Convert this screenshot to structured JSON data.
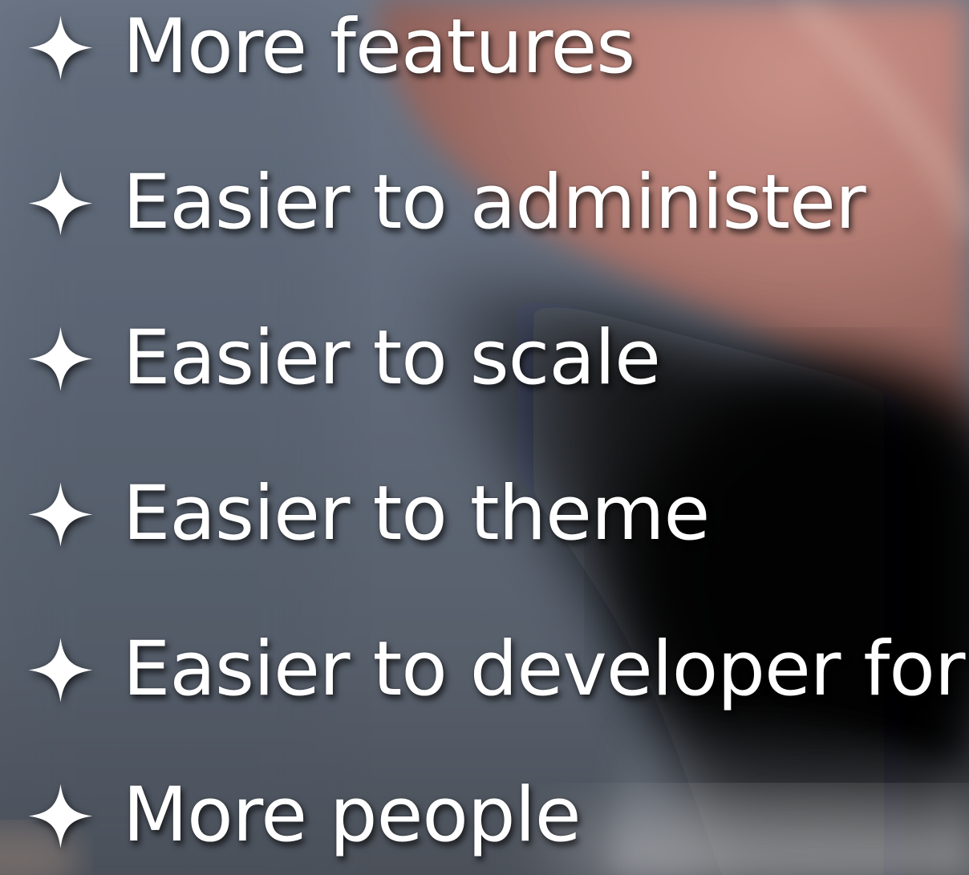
{
  "slide": {
    "bullet_icon": "four-point-star-icon",
    "text_color": "#ffffff",
    "items": [
      "More features",
      "Easier to administer",
      "Easier to scale",
      "Easier to theme",
      "Easier to developer for",
      "More people"
    ]
  }
}
